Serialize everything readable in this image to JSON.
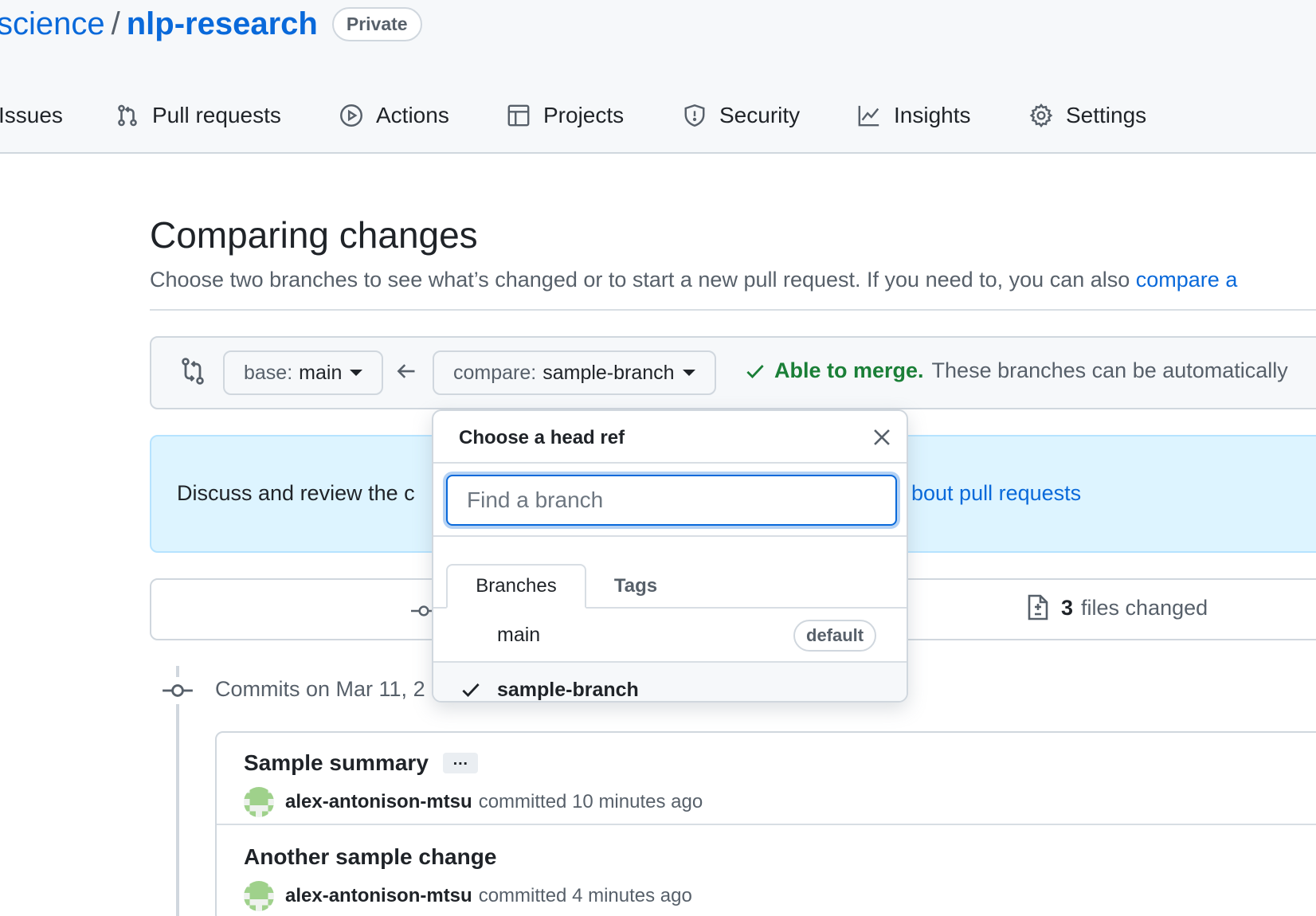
{
  "repo": {
    "owner": "science",
    "separator": "/",
    "name": "nlp-research",
    "visibility": "Private"
  },
  "nav": {
    "items": [
      {
        "label": "Issues",
        "icon": "issue-opened-icon"
      },
      {
        "label": "Pull requests",
        "icon": "git-pull-request-icon"
      },
      {
        "label": "Actions",
        "icon": "play-icon"
      },
      {
        "label": "Projects",
        "icon": "table-icon"
      },
      {
        "label": "Security",
        "icon": "shield-icon"
      },
      {
        "label": "Insights",
        "icon": "graph-icon"
      },
      {
        "label": "Settings",
        "icon": "gear-icon"
      }
    ]
  },
  "page": {
    "title": "Comparing changes",
    "description": "Choose two branches to see what’s changed or to start a new pull request. If you need to, you can also ",
    "description_link": "compare a"
  },
  "range": {
    "base_prefix": "base:",
    "base_branch": "main",
    "compare_prefix": "compare:",
    "compare_branch": "sample-branch",
    "merge_status": "Able to merge.",
    "merge_text": "These branches can be automatically",
    "merge_color": "#1a7f37"
  },
  "info": {
    "text": "Discuss and review the c",
    "link": "bout pull requests"
  },
  "stats": {
    "files_changed_count": "3",
    "files_changed_label": "files changed"
  },
  "commits": {
    "date_heading": "Commits on Mar 11, 2",
    "items": [
      {
        "message": "Sample summary",
        "ellipsis": "…",
        "author": "alex-antonison-mtsu",
        "action": "committed",
        "time": "10 minutes ago"
      },
      {
        "message": "Another sample change",
        "author": "alex-antonison-mtsu",
        "action": "committed",
        "time": "4 minutes ago"
      }
    ]
  },
  "dropdown": {
    "title": "Choose a head ref",
    "filter_placeholder": "Find a branch",
    "filter_value": "",
    "tabs": [
      "Branches",
      "Tags"
    ],
    "active_tab": "Branches",
    "branches": [
      {
        "name": "main",
        "badge": "default",
        "selected": false
      },
      {
        "name": "sample-branch",
        "badge": "",
        "selected": true
      }
    ]
  },
  "colors": {
    "link": "#0969da",
    "focus": "#0969da",
    "info_bg": "#ddf4ff"
  }
}
